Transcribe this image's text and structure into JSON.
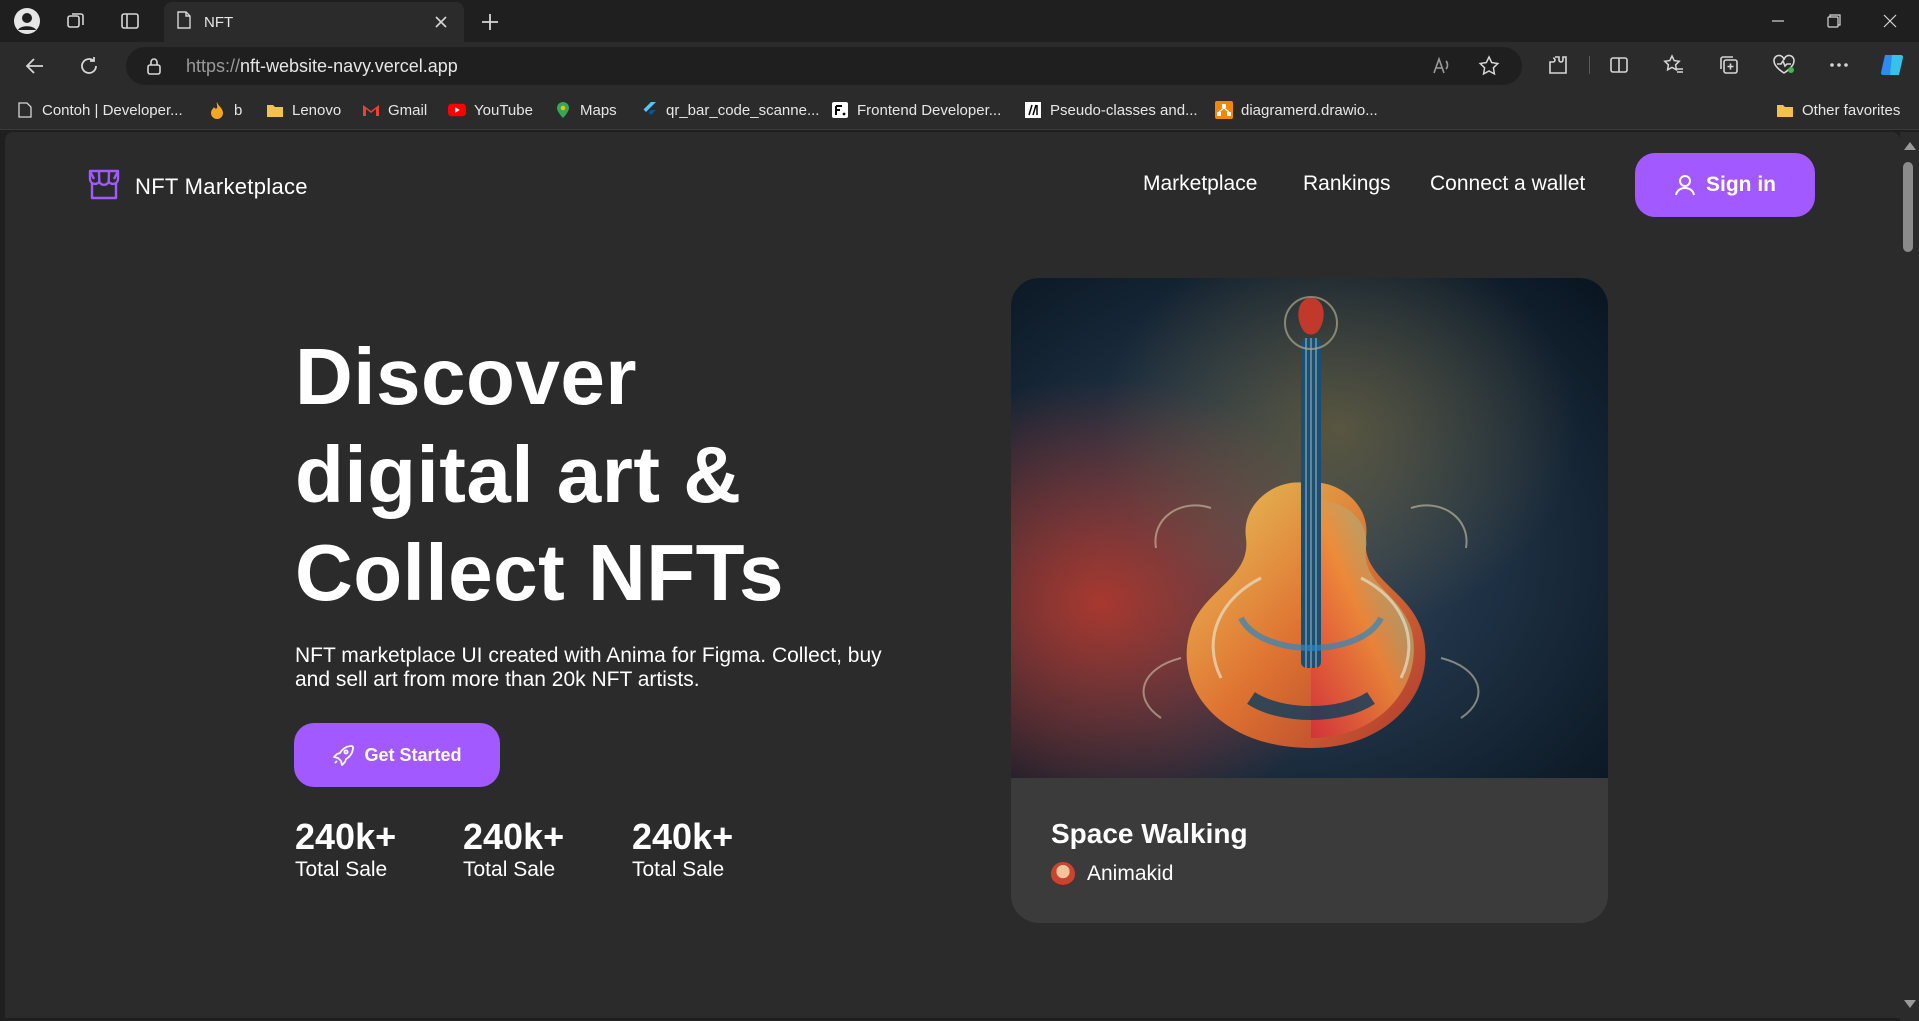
{
  "browser": {
    "tab_title": "NFT",
    "url_prefix": "https://",
    "url_host": "nft-website-navy.vercel.app",
    "bookmarks": [
      {
        "label": "Contoh | Developer...",
        "icon": "page-icon"
      },
      {
        "label": "b",
        "icon": "fire-icon"
      },
      {
        "label": "Lenovo",
        "icon": "folder-icon"
      },
      {
        "label": "Gmail",
        "icon": "gmail-icon"
      },
      {
        "label": "YouTube",
        "icon": "youtube-icon"
      },
      {
        "label": "Maps",
        "icon": "maps-pin-icon"
      },
      {
        "label": "qr_bar_code_scanne...",
        "icon": "flutter-icon"
      },
      {
        "label": "Frontend Developer...",
        "icon": "frontend-icon"
      },
      {
        "label": "Pseudo-classes and...",
        "icon": "mdn-icon"
      },
      {
        "label": "diagramerd.drawio...",
        "icon": "drawio-icon"
      }
    ],
    "other_favorites": "Other favorites"
  },
  "site": {
    "logo_text": "NFT Marketplace",
    "nav": [
      "Marketplace",
      "Rankings",
      "Connect a wallet"
    ],
    "sign_in": "Sign in",
    "accent": "#a259ff"
  },
  "hero": {
    "title_lines": [
      "Discover",
      "digital art &",
      "Collect NFTs"
    ],
    "subtitle": "NFT marketplace UI created with Anima for Figma. Collect, buy and sell art from more than 20k NFT artists.",
    "cta": "Get Started",
    "stats": [
      {
        "value": "240k+",
        "label": "Total Sale"
      },
      {
        "value": "240k+",
        "label": "Total Sale"
      },
      {
        "value": "240k+",
        "label": "Total Sale"
      }
    ]
  },
  "featured": {
    "title": "Space Walking",
    "artist": "Animakid"
  }
}
